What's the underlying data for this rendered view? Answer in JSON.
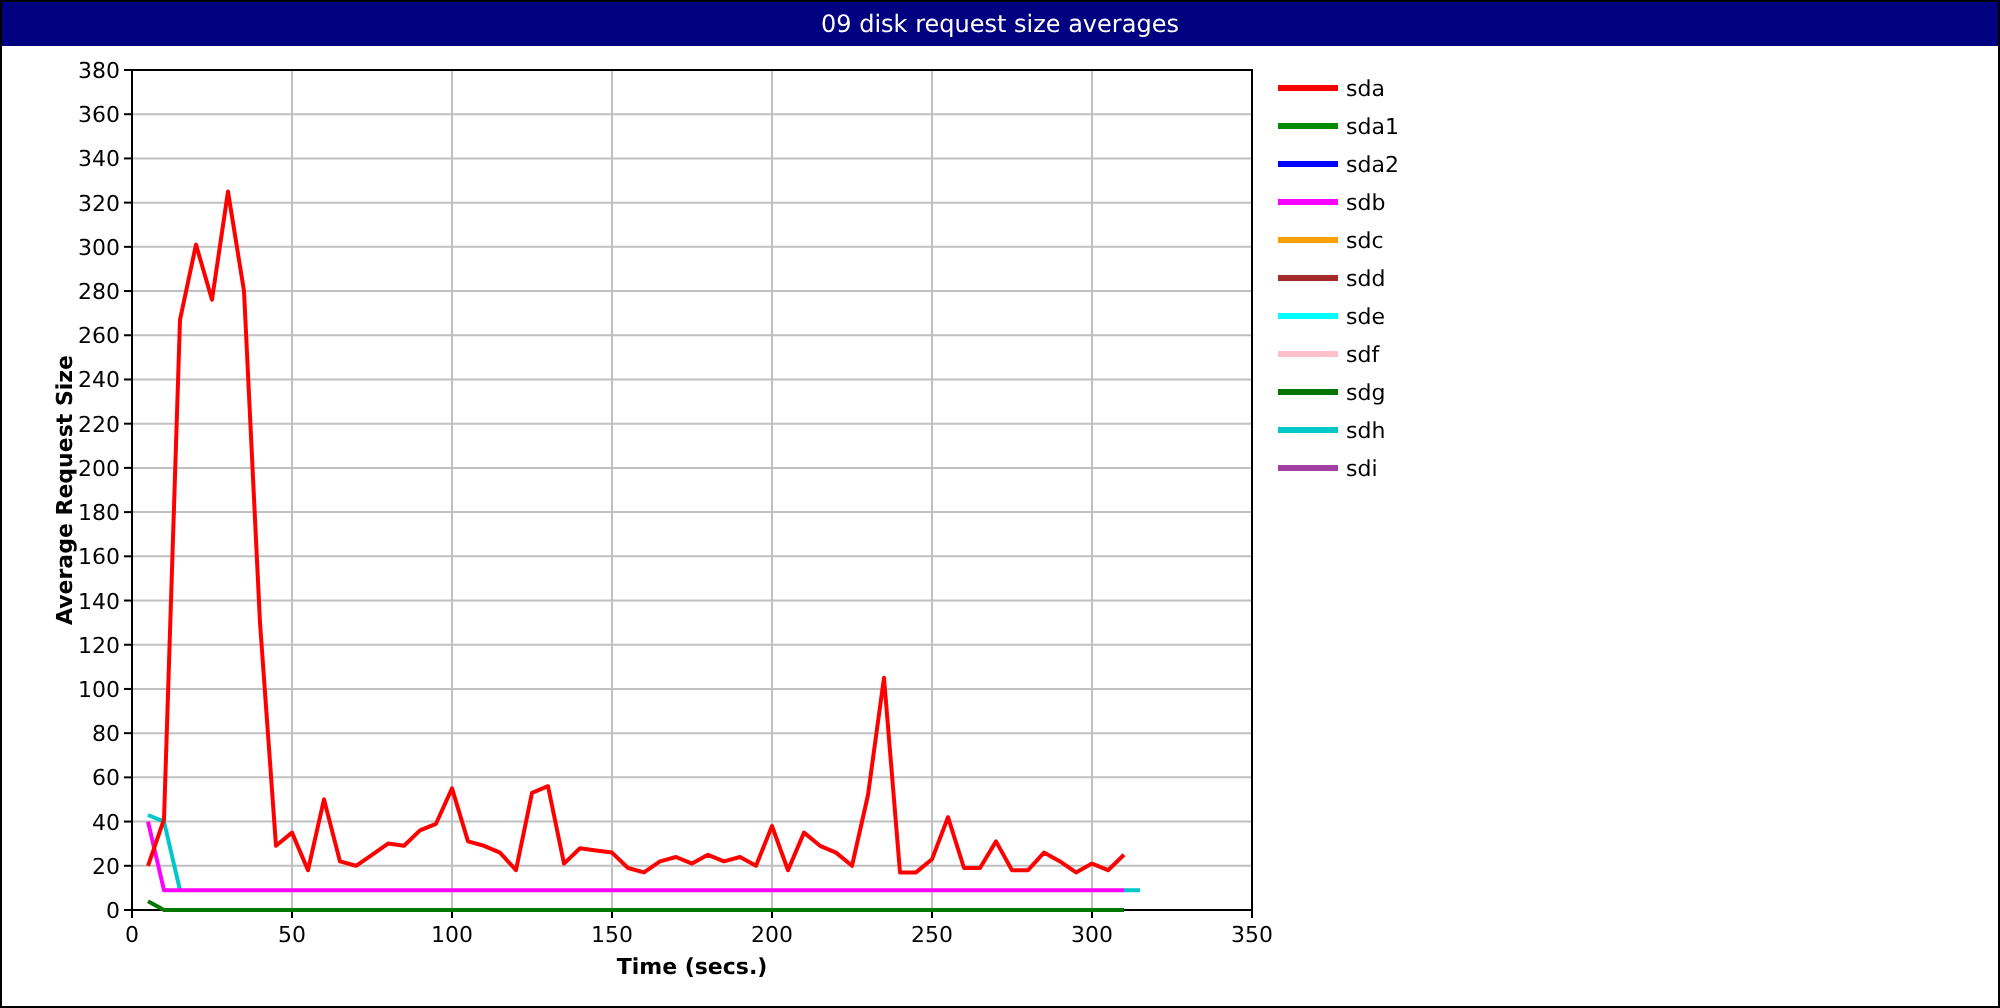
{
  "window": {
    "title": "09 disk request size averages"
  },
  "chart_data": {
    "type": "line",
    "xlabel": "Time (secs.)",
    "ylabel": "Average Request Size",
    "xlim": [
      0,
      350
    ],
    "ylim": [
      0,
      380
    ],
    "grid": true,
    "legend": true,
    "xticks": [
      0,
      50,
      100,
      150,
      200,
      250,
      300,
      350
    ],
    "yticks": [
      0,
      20,
      40,
      60,
      80,
      100,
      120,
      140,
      160,
      180,
      200,
      220,
      240,
      260,
      280,
      300,
      320,
      340,
      360,
      380
    ],
    "x": [
      5,
      10,
      15,
      20,
      25,
      30,
      35,
      40,
      45,
      50,
      55,
      60,
      65,
      70,
      75,
      80,
      85,
      90,
      95,
      100,
      105,
      110,
      115,
      120,
      125,
      130,
      135,
      140,
      145,
      150,
      155,
      160,
      165,
      170,
      175,
      180,
      185,
      190,
      195,
      200,
      205,
      210,
      215,
      220,
      225,
      230,
      235,
      240,
      245,
      250,
      255,
      260,
      265,
      270,
      275,
      280,
      285,
      290,
      295,
      300,
      305,
      310,
      315
    ],
    "series": [
      {
        "name": "sda",
        "color": "#ff0000",
        "values": [
          20,
          41,
          267,
          301,
          276,
          325,
          280,
          130,
          29,
          35,
          18,
          50,
          22,
          20,
          25,
          30,
          29,
          36,
          39,
          55,
          31,
          29,
          26,
          18,
          53,
          56,
          21,
          28,
          27,
          26,
          19,
          17,
          22,
          24,
          21,
          25,
          22,
          24,
          20,
          38,
          18,
          35,
          29,
          26,
          20,
          52,
          105,
          17,
          17,
          23,
          42,
          19,
          19,
          31,
          18,
          18,
          26,
          22,
          17,
          21,
          18,
          25,
          null
        ]
      },
      {
        "name": "sda1",
        "color": "#008c00",
        "values": [
          null,
          null,
          null,
          null,
          null,
          null,
          null,
          null,
          null,
          null,
          null,
          null,
          null,
          null,
          null,
          null,
          null,
          null,
          null,
          null,
          null,
          null,
          null,
          null,
          null,
          null,
          null,
          null,
          null,
          null,
          null,
          null,
          null,
          null,
          null,
          null,
          null,
          null,
          null,
          null,
          null,
          null,
          null,
          null,
          null,
          null,
          null,
          null,
          null,
          null,
          null,
          null,
          null,
          null,
          null,
          null,
          null,
          null,
          null,
          null,
          null,
          null,
          null
        ]
      },
      {
        "name": "sda2",
        "color": "#0000ff",
        "values": [
          null,
          null,
          null,
          null,
          null,
          null,
          null,
          null,
          null,
          null,
          null,
          null,
          null,
          null,
          null,
          null,
          null,
          null,
          null,
          null,
          null,
          null,
          null,
          null,
          null,
          null,
          null,
          null,
          null,
          null,
          null,
          null,
          null,
          null,
          null,
          null,
          null,
          null,
          null,
          null,
          null,
          null,
          null,
          null,
          null,
          null,
          null,
          null,
          null,
          null,
          null,
          null,
          null,
          null,
          null,
          null,
          null,
          null,
          null,
          null,
          null,
          null,
          null
        ]
      },
      {
        "name": "sdb",
        "color": "#ff00ff",
        "values": [
          40,
          9,
          9,
          9,
          9,
          9,
          9,
          9,
          9,
          9,
          9,
          9,
          9,
          9,
          9,
          9,
          9,
          9,
          9,
          9,
          9,
          9,
          9,
          9,
          9,
          9,
          9,
          9,
          9,
          9,
          9,
          9,
          9,
          9,
          9,
          9,
          9,
          9,
          9,
          9,
          9,
          9,
          9,
          9,
          9,
          9,
          9,
          9,
          9,
          9,
          9,
          9,
          9,
          9,
          9,
          9,
          9,
          9,
          9,
          9,
          9,
          9,
          null
        ]
      },
      {
        "name": "sdc",
        "color": "#ffa000",
        "values": [
          null,
          null,
          null,
          null,
          null,
          null,
          null,
          null,
          null,
          null,
          null,
          null,
          null,
          null,
          null,
          null,
          null,
          null,
          null,
          null,
          null,
          null,
          null,
          null,
          null,
          null,
          null,
          null,
          null,
          null,
          null,
          null,
          null,
          null,
          null,
          null,
          null,
          null,
          null,
          null,
          null,
          null,
          null,
          null,
          null,
          null,
          null,
          null,
          null,
          null,
          null,
          null,
          null,
          null,
          null,
          null,
          null,
          null,
          null,
          null,
          null,
          null,
          null
        ]
      },
      {
        "name": "sdd",
        "color": "#a52a2a",
        "values": [
          null,
          null,
          null,
          null,
          null,
          null,
          null,
          null,
          null,
          null,
          null,
          null,
          null,
          null,
          null,
          null,
          null,
          null,
          null,
          null,
          null,
          null,
          null,
          null,
          null,
          null,
          null,
          null,
          null,
          null,
          null,
          null,
          null,
          null,
          null,
          null,
          null,
          null,
          null,
          null,
          null,
          null,
          null,
          null,
          null,
          null,
          null,
          null,
          null,
          null,
          null,
          null,
          null,
          null,
          null,
          null,
          null,
          null,
          null,
          null,
          null,
          null,
          null
        ]
      },
      {
        "name": "sde",
        "color": "#00ffff",
        "values": [
          null,
          null,
          null,
          null,
          null,
          null,
          null,
          null,
          null,
          null,
          null,
          null,
          null,
          null,
          null,
          null,
          null,
          null,
          null,
          null,
          null,
          null,
          null,
          null,
          null,
          null,
          null,
          null,
          null,
          null,
          null,
          null,
          null,
          null,
          null,
          null,
          null,
          null,
          null,
          null,
          null,
          null,
          null,
          null,
          null,
          null,
          null,
          null,
          null,
          null,
          null,
          null,
          null,
          null,
          null,
          null,
          null,
          null,
          null,
          null,
          null,
          null,
          null
        ]
      },
      {
        "name": "sdf",
        "color": "#ffc0cb",
        "values": [
          null,
          null,
          null,
          null,
          null,
          null,
          null,
          null,
          null,
          null,
          null,
          null,
          null,
          null,
          null,
          null,
          null,
          null,
          null,
          null,
          null,
          null,
          null,
          null,
          null,
          null,
          null,
          null,
          null,
          null,
          null,
          null,
          null,
          null,
          null,
          null,
          null,
          null,
          null,
          null,
          null,
          null,
          null,
          null,
          null,
          null,
          null,
          null,
          null,
          null,
          null,
          null,
          null,
          null,
          null,
          null,
          null,
          null,
          null,
          null,
          null,
          null,
          null
        ]
      },
      {
        "name": "sdg",
        "color": "#007800",
        "values": [
          4,
          0,
          0,
          0,
          0,
          0,
          0,
          0,
          0,
          0,
          0,
          0,
          0,
          0,
          0,
          0,
          0,
          0,
          0,
          0,
          0,
          0,
          0,
          0,
          0,
          0,
          0,
          0,
          0,
          0,
          0,
          0,
          0,
          0,
          0,
          0,
          0,
          0,
          0,
          0,
          0,
          0,
          0,
          0,
          0,
          0,
          0,
          0,
          0,
          0,
          0,
          0,
          0,
          0,
          0,
          0,
          0,
          0,
          0,
          0,
          0,
          0,
          null
        ]
      },
      {
        "name": "sdh",
        "color": "#00c8c8",
        "values": [
          43,
          40,
          9,
          null,
          null,
          null,
          null,
          null,
          null,
          null,
          null,
          null,
          null,
          null,
          null,
          null,
          null,
          null,
          null,
          null,
          null,
          null,
          null,
          null,
          null,
          null,
          null,
          null,
          null,
          null,
          null,
          null,
          null,
          null,
          null,
          null,
          null,
          null,
          null,
          null,
          null,
          null,
          null,
          null,
          null,
          null,
          null,
          null,
          null,
          null,
          null,
          null,
          null,
          null,
          null,
          null,
          null,
          null,
          null,
          null,
          null,
          9,
          9
        ]
      },
      {
        "name": "sdi",
        "color": "#a040a0",
        "values": [
          null,
          null,
          null,
          null,
          null,
          null,
          null,
          null,
          null,
          null,
          null,
          null,
          null,
          null,
          null,
          null,
          null,
          null,
          null,
          null,
          null,
          null,
          null,
          null,
          null,
          null,
          null,
          null,
          null,
          null,
          null,
          null,
          null,
          null,
          null,
          null,
          null,
          null,
          null,
          null,
          null,
          null,
          null,
          null,
          null,
          null,
          null,
          null,
          null,
          null,
          null,
          null,
          null,
          null,
          null,
          null,
          null,
          null,
          null,
          null,
          null,
          null,
          null
        ]
      }
    ]
  }
}
